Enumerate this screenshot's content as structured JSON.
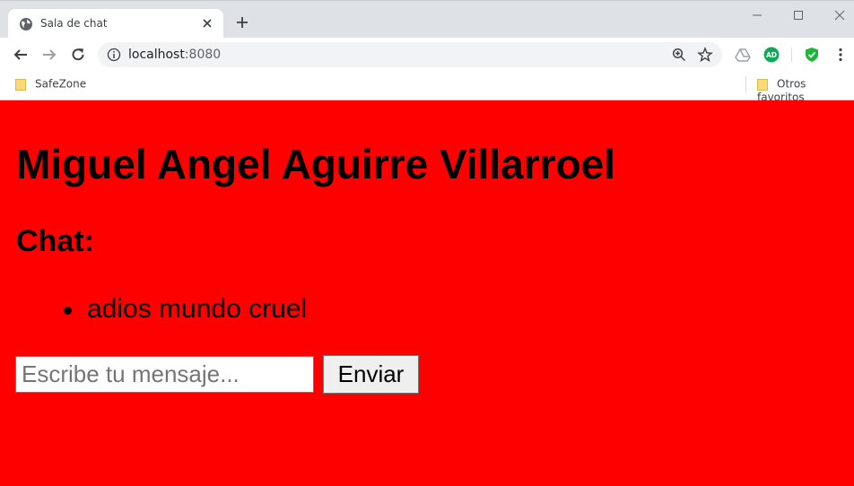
{
  "browser": {
    "tab_title": "Sala de chat",
    "url_host": "localhost",
    "url_port": ":8080",
    "bookmarks": [
      "SafeZone"
    ],
    "other_bookmarks": "Otros favoritos",
    "extensions": [
      {
        "name": "drive-icon"
      },
      {
        "name": "adblock-icon",
        "label": "AD",
        "color": "#0fa958"
      },
      {
        "name": "shield-check-icon",
        "color": "#1eb53a"
      }
    ]
  },
  "page": {
    "background": "#ff0000",
    "heading": "Miguel Angel Aguirre Villarroel",
    "subheading": "Chat:",
    "messages": [
      "adios mundo cruel"
    ],
    "input_placeholder": "Escribe tu mensaje...",
    "send_label": "Enviar"
  }
}
